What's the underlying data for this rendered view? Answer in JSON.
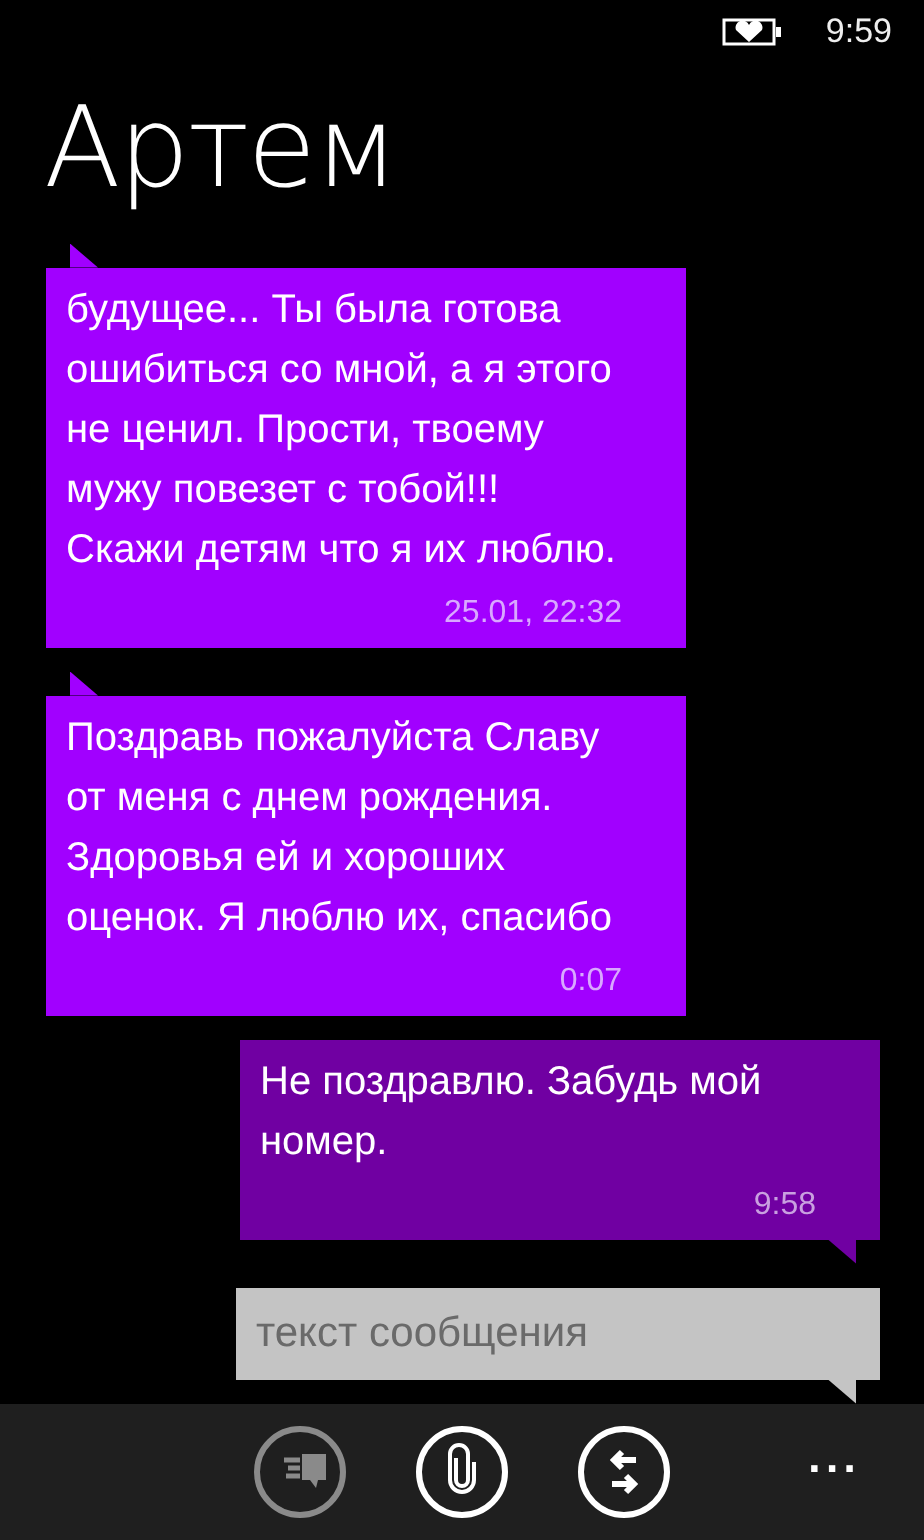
{
  "status_bar": {
    "time": "9:59"
  },
  "header": {
    "title": "Артем"
  },
  "messages": [
    {
      "kind": "received",
      "text": "будущее... Ты была готова ошибиться со мной, а я этого не ценил. Прости, твоему мужу повезет с тобой!!! Скажи детям что я их люблю.",
      "time": "25.01, 22:32"
    },
    {
      "kind": "received",
      "text": "Поздравь пожалуйста Славу от меня с днем рождения. Здоровья ей и хороших оценок. Я люблю их, спасибо",
      "time": "0:07"
    },
    {
      "kind": "sent",
      "text": "Не поздравлю. Забудь мой номер.",
      "time": "9:58"
    }
  ],
  "compose": {
    "placeholder": "текст сообщения"
  },
  "app_bar": {
    "buttons": [
      {
        "kind": "chat",
        "disabled": true
      },
      {
        "kind": "attach",
        "disabled": false
      },
      {
        "kind": "switch",
        "disabled": false
      }
    ],
    "more": "..."
  }
}
